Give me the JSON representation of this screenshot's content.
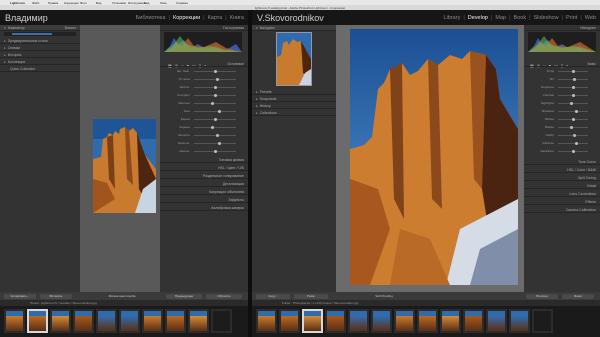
{
  "menubar": {
    "app": "Lightroom",
    "items": [
      "Файл",
      "Правка",
      "Коррекции",
      "Фото",
      "Вид",
      "Установки",
      "Инструменты",
      "Вид",
      "Окно",
      "Справка"
    ]
  },
  "titlebar": {
    "title": "lightroom-5-catalog.lrcat - Adobe Photoshop Lightroom - Коррекции"
  },
  "left": {
    "identity": "Владимир",
    "modules": [
      "Библиотека",
      "Коррекции",
      "Карта",
      "Книга"
    ],
    "active_module": "Коррекции",
    "navigator_label": "Навигатор",
    "navigator_value": "Вписат",
    "left_panels": [
      "Предварительные стили",
      "Снимки",
      "История",
      "Коллекции"
    ],
    "collection_item": "Quick Collection",
    "right_top_label": "Гистограмма",
    "tone_curve": "Тоновая кривая",
    "right_panels": [
      "HSL / Цвет / Ч/Б",
      "Раздельное тонирование",
      "Детализация",
      "Коррекция объектива",
      "Эффекты",
      "Калибровка камеры"
    ],
    "basic_label": "Основные",
    "sliders": [
      {
        "label": "Цв. темп.",
        "pos": 0.5
      },
      {
        "label": "Оттенок",
        "pos": 0.55
      },
      {
        "label": "Экспоз.",
        "pos": 0.5
      },
      {
        "label": "Контраст",
        "pos": 0.5
      },
      {
        "label": "Светлые",
        "pos": 0.45
      },
      {
        "label": "Тени",
        "pos": 0.6
      },
      {
        "label": "Белые",
        "pos": 0.5
      },
      {
        "label": "Черные",
        "pos": 0.45
      },
      {
        "label": "Четкость",
        "pos": 0.55
      },
      {
        "label": "Красочн.",
        "pos": 0.6
      },
      {
        "label": "Насыщ.",
        "pos": 0.5
      }
    ],
    "toolbar_left": [
      "Копировать...",
      "Вставить"
    ],
    "toolbar_mid": "Мягкая цветопроба",
    "toolbar_right": [
      "Предыдущее",
      "Сбросить"
    ]
  },
  "right": {
    "identity": "V.Skovorodnikov",
    "modules": [
      "Library",
      "Develop",
      "Map",
      "Book",
      "Slideshow",
      "Print",
      "Web"
    ],
    "active_module": "Develop",
    "navigator_label": "Navigator",
    "left_panels": [
      "Presets",
      "Snapshots",
      "History",
      "Collections"
    ],
    "right_top_label": "Histogram",
    "basic_label": "Basic",
    "right_panels": [
      "Tone Curve",
      "HSL / Color / B&W",
      "Split Toning",
      "Detail",
      "Lens Corrections",
      "Effects",
      "Camera Calibration"
    ],
    "toolbar_left": [
      "Copy...",
      "Paste"
    ],
    "toolbar_mid": "Soft Proofing",
    "toolbar_right": [
      "Previous",
      "Reset"
    ],
    "sliders": [
      {
        "label": "Temp",
        "pos": 0.5
      },
      {
        "label": "Tint",
        "pos": 0.55
      },
      {
        "label": "Exposure",
        "pos": 0.5
      },
      {
        "label": "Contrast",
        "pos": 0.5
      },
      {
        "label": "Highlights",
        "pos": 0.45
      },
      {
        "label": "Shadows",
        "pos": 0.6
      },
      {
        "label": "Whites",
        "pos": 0.5
      },
      {
        "label": "Blacks",
        "pos": 0.45
      },
      {
        "label": "Clarity",
        "pos": 0.55
      },
      {
        "label": "Vibrance",
        "pos": 0.6
      },
      {
        "label": "Saturation",
        "pos": 0.5
      }
    ]
  },
  "filmstrip": {
    "left_path": "Папка : Lightroom 5 / Снимки / Skovorodnikov.jpg",
    "right_path": "Folder : Photographs / 1 of 23 photos / Skovorodnikov.jpg",
    "left_count": 10,
    "right_count": 13,
    "left_selected": 1,
    "right_selected": 2
  },
  "colors": {
    "sky": "#3a78b8",
    "rock": "#c8742a",
    "shadow": "#5a2e14",
    "snow": "#d8dde6"
  }
}
